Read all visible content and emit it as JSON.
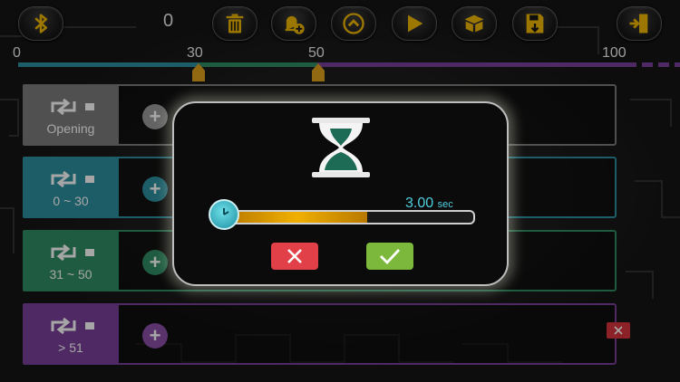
{
  "toolbar": {
    "counter": "0",
    "buttons": [
      "bluetooth",
      "delete",
      "add-scene",
      "collapse",
      "play",
      "package",
      "save",
      "exit"
    ]
  },
  "timeline": {
    "labels": [
      "0",
      "30",
      "50",
      "100"
    ],
    "markers": [
      30,
      50
    ],
    "colors": {
      "teal": "#2c8fa0",
      "green": "#2f8c63",
      "purple": "#7a3f98"
    }
  },
  "rows": [
    {
      "label": "Opening",
      "color": "#7c7c7c"
    },
    {
      "label": "0 ~ 30",
      "color": "#2c8fa0"
    },
    {
      "label": "31 ~ 50",
      "color": "#2f8c63"
    },
    {
      "label": "> 51",
      "color": "#7a3f98"
    }
  ],
  "dialog": {
    "duration_value": "3.00",
    "duration_unit": "sec",
    "slider_fraction": 0.57,
    "cancel_icon": "close-icon",
    "confirm_icon": "check-icon"
  }
}
